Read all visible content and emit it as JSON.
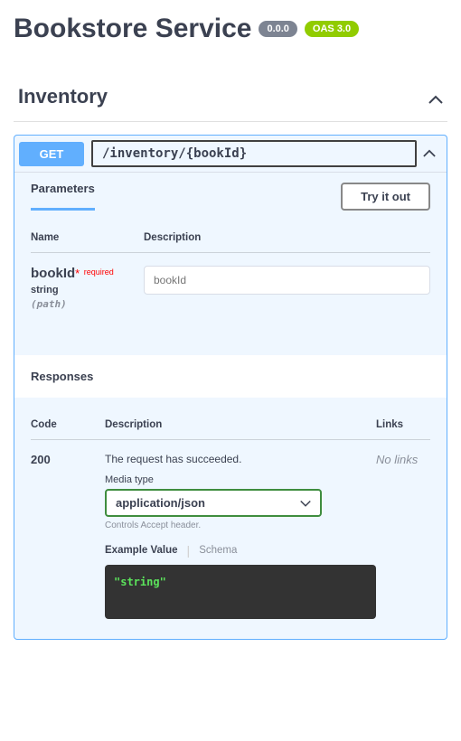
{
  "header": {
    "title": "Bookstore Service",
    "version": "0.0.0",
    "oas": "OAS 3.0"
  },
  "section": {
    "name": "Inventory"
  },
  "operation": {
    "method": "GET",
    "path": "/inventory/{bookId}"
  },
  "paramsHeader": {
    "tab": "Parameters",
    "tryBtn": "Try it out"
  },
  "paramsTable": {
    "colName": "Name",
    "colDesc": "Description"
  },
  "param": {
    "name": "bookId",
    "requiredStar": "*",
    "requiredText": " required",
    "type": "string",
    "in": "(path)",
    "placeholder": "bookId"
  },
  "responses": {
    "title": "Responses",
    "colCode": "Code",
    "colDesc": "Description",
    "colLinks": "Links"
  },
  "response200": {
    "code": "200",
    "desc": "The request has succeeded.",
    "mediaLabel": "Media type",
    "mediaValue": "application/json",
    "controlsText": "Controls Accept header.",
    "tabExample": "Example Value",
    "tabSchema": "Schema",
    "exampleBody": "\"string\"",
    "links": "No links"
  }
}
